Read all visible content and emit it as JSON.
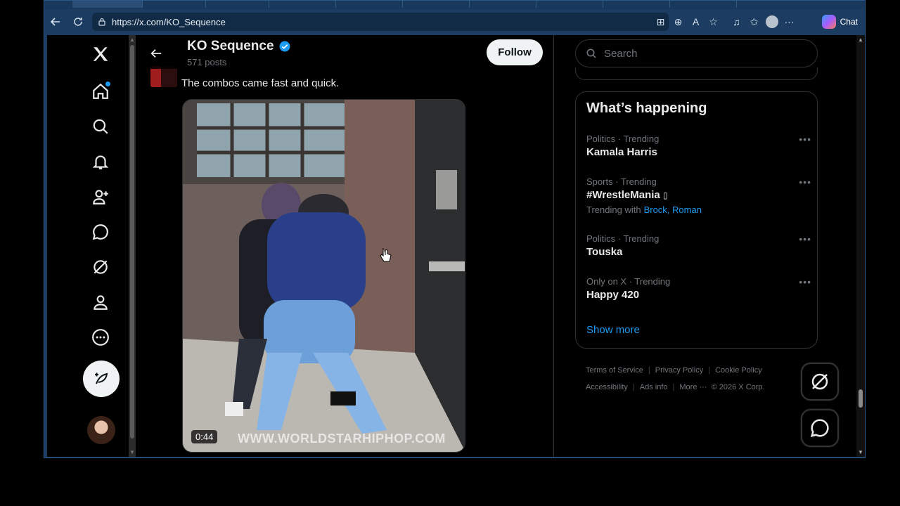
{
  "browser": {
    "url": "https://x.com/KO_Sequence",
    "chat_label": "Chat"
  },
  "profile": {
    "name": "KO Sequence",
    "post_count": "571 posts",
    "follow_label": "Follow"
  },
  "tweet": {
    "text": "The combos came fast and quick.",
    "video_duration": "0:44",
    "video_watermark": "WWW.WORLDSTARHIPHOP.COM"
  },
  "search": {
    "placeholder": "Search"
  },
  "happening": {
    "title": "What’s happening",
    "trends": [
      {
        "meta": "Politics · Trending",
        "name": "Kamala Harris"
      },
      {
        "meta": "Sports · Trending",
        "name": "#WrestleMania",
        "with_label": "Trending with",
        "with_links": "Brock, Roman"
      },
      {
        "meta": "Politics · Trending",
        "name": "Touska"
      },
      {
        "meta": "Only on X · Trending",
        "name": "Happy 420"
      }
    ],
    "show_more": "Show more"
  },
  "footer": {
    "terms": "Terms of Service",
    "privacy": "Privacy Policy",
    "cookie": "Cookie Policy",
    "accessibility": "Accessibility",
    "ads": "Ads info",
    "more": "More ···",
    "copyright": "© 2026 X Corp."
  },
  "icons": {
    "nav": [
      "x-logo-icon",
      "home-icon",
      "search-icon",
      "notifications-icon",
      "follow-icon",
      "messages-icon",
      "grok-icon",
      "profile-icon",
      "more-icon"
    ],
    "accent": "#1d9bf0"
  }
}
